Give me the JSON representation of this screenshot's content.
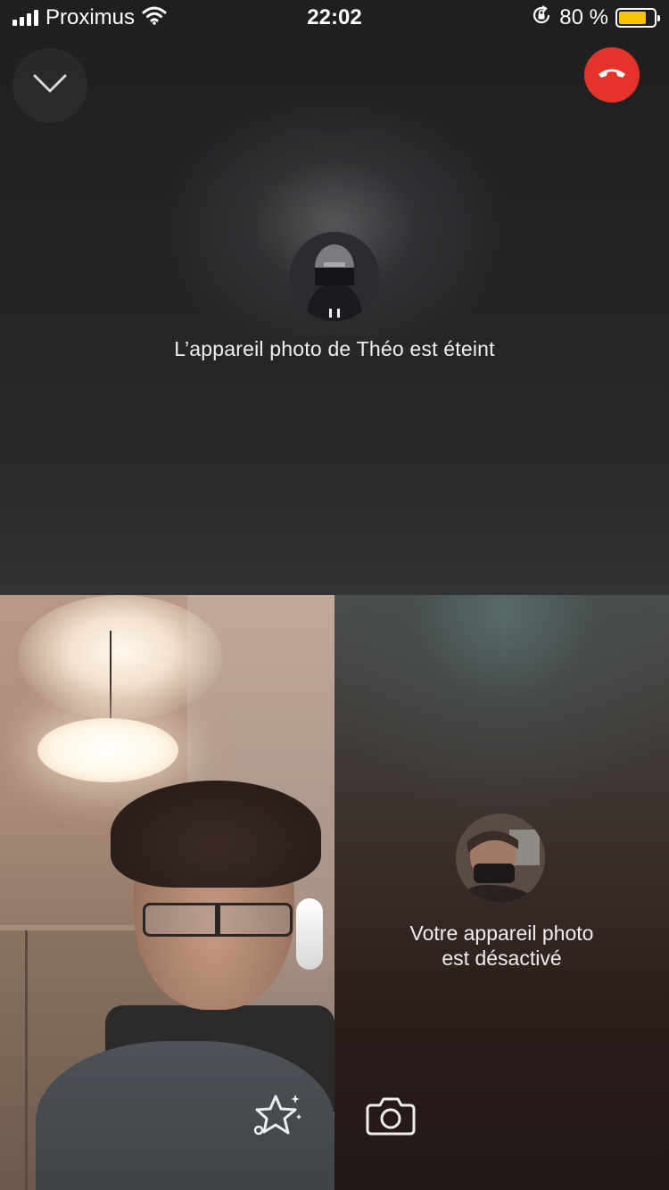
{
  "status_bar": {
    "carrier": "Proximus",
    "time": "22:02",
    "battery_percent": "80 %",
    "battery_level": 0.8,
    "icons": [
      "signal-icon",
      "wifi-icon",
      "orientation-lock-icon",
      "battery-icon"
    ]
  },
  "call": {
    "collapse_icon": "chevron-down-icon",
    "end_call_icon": "phone-hangup-icon",
    "end_call_color": "#e4332b",
    "remote_camera_message": "L’appareil photo de Théo est éteint",
    "own_camera_message_line1": "Votre appareil photo",
    "own_camera_message_line2": "est désactivé"
  },
  "controls": {
    "effects_icon": "sparkle-star-icon",
    "camera_icon": "camera-icon"
  },
  "colors": {
    "battery": "#f5c500"
  }
}
